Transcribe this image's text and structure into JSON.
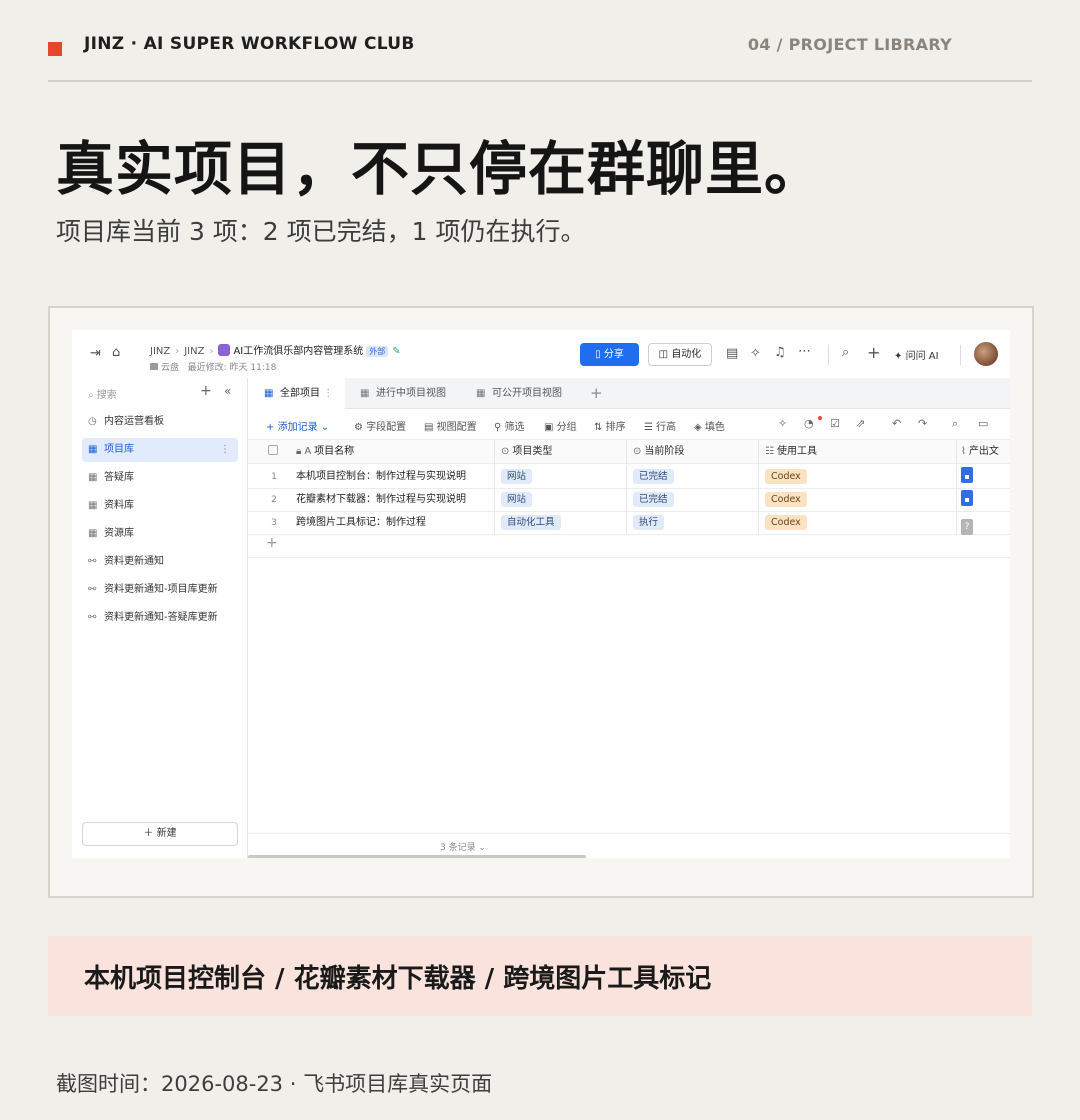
{
  "header": {
    "brand": "JINZ · AI SUPER WORKFLOW CLUB",
    "section": "04 / PROJECT LIBRARY",
    "accent_color": "#e4472b"
  },
  "headline": "真实项目，不只停在群聊里。",
  "subline": "项目库当前 3 项：2 项已完结，1 项仍在执行。",
  "app": {
    "breadcrumb": [
      "JINZ",
      "JINZ",
      "AI工作流俱乐部内容管理系统"
    ],
    "external_tag": "外部",
    "meta": {
      "location": "云盘",
      "last_modified": "最近修改: 昨天 11:18"
    },
    "share_label": "分享",
    "automation_label": "自动化",
    "ask_ai_label": "问问 AI",
    "sidebar": {
      "search_placeholder": "搜索",
      "items": [
        {
          "label": "内容运营看板",
          "icon": "dashboard-icon"
        },
        {
          "label": "项目库",
          "icon": "table-icon",
          "active": true
        },
        {
          "label": "答疑库",
          "icon": "table-icon"
        },
        {
          "label": "资料库",
          "icon": "table-icon"
        },
        {
          "label": "资源库",
          "icon": "table-icon"
        },
        {
          "label": "资料更新通知",
          "icon": "workflow-icon"
        },
        {
          "label": "资料更新通知-项目库更新",
          "icon": "workflow-icon"
        },
        {
          "label": "资料更新通知-答疑库更新",
          "icon": "workflow-icon"
        }
      ],
      "new_label": "＋ 新建"
    },
    "tabs": [
      {
        "label": "全部项目",
        "active": true
      },
      {
        "label": "进行中项目视图"
      },
      {
        "label": "可公开项目视图"
      }
    ],
    "toolbar": {
      "add_record": "添加记录",
      "field_config": "字段配置",
      "view_config": "视图配置",
      "filter": "筛选",
      "group": "分组",
      "sort": "排序",
      "row_height": "行高",
      "fill_color": "填色"
    },
    "table": {
      "columns": [
        "项目名称",
        "项目类型",
        "当前阶段",
        "使用工具",
        "产出文"
      ],
      "rows": [
        {
          "index": "1",
          "name": "本机项目控制台：制作过程与实现说明",
          "type": "网站",
          "stage": "已完结",
          "tool": "Codex",
          "doc": "doc"
        },
        {
          "index": "2",
          "name": "花瓣素材下载器：制作过程与实现说明",
          "type": "网站",
          "stage": "已完结",
          "tool": "Codex",
          "doc": "doc"
        },
        {
          "index": "3",
          "name": "跨境图片工具标记：制作过程",
          "type": "自动化工具",
          "stage": "执行",
          "tool": "Codex",
          "doc": "unknown"
        }
      ],
      "record_count": "3 条记录"
    }
  },
  "banner": "本机项目控制台 / 花瓣素材下载器 / 跨境图片工具标记",
  "caption": "截图时间：2026-08-23 · 飞书项目库真实页面"
}
